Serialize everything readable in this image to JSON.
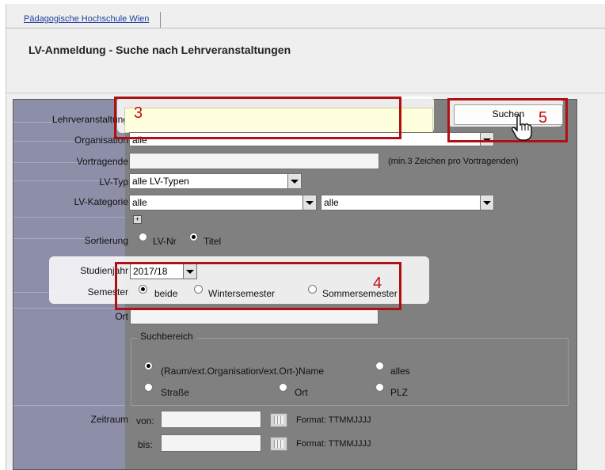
{
  "tabs": [
    "Pädagogische Hochschule Wien"
  ],
  "page_title": "LV-Anmeldung - Suche nach Lehrveranstaltungen",
  "labels": {
    "lehrveranstaltung": "Lehrveranstaltung",
    "organisation": "Organisation",
    "vortragende": "Vortragende",
    "lvtyp": "LV-Typ",
    "lvkategorie": "LV-Kategorie",
    "sortierung": "Sortierung",
    "studienjahr": "Studienjahr",
    "semester": "Semester",
    "ort": "Ort",
    "zeitraum": "Zeitraum"
  },
  "fields": {
    "lehrveranstaltung_value": "",
    "organisation_value": "alle",
    "vortragende_hint": "(min.3 Zeichen pro Vortragenden)",
    "lvtyp_value": "alle LV-Typen",
    "lvkategorie_value_1": "alle",
    "lvkategorie_value_2": "alle",
    "sortierung_options": [
      "LV-Nr",
      "Titel"
    ],
    "sortierung_selected": "Titel",
    "studienjahr_value": "2017/18",
    "semester_options": [
      "beide",
      "Wintersemester",
      "Sommersemester"
    ],
    "semester_selected": "beide"
  },
  "suchbereich": {
    "legend": "Suchbereich",
    "options": [
      "(Raum/ext.Organisation/ext.Ort-)Name",
      "alles",
      "Straße",
      "Ort",
      "PLZ"
    ],
    "selected": "(Raum/ext.Organisation/ext.Ort-)Name"
  },
  "zeitraum": {
    "von_label": "von:",
    "bis_label": "bis:",
    "format_von": "Format: TTMMJJJJ",
    "format_bis": "Format: TTMMJJJJ"
  },
  "search_button": "Suchen",
  "annotations": {
    "n3": "3",
    "n4": "4",
    "n5": "5"
  },
  "colors": {
    "annotation_red": "#b01010",
    "label_column": "#8d8ea8",
    "form_bg": "#808080",
    "input_highlight": "#ffffdd"
  }
}
